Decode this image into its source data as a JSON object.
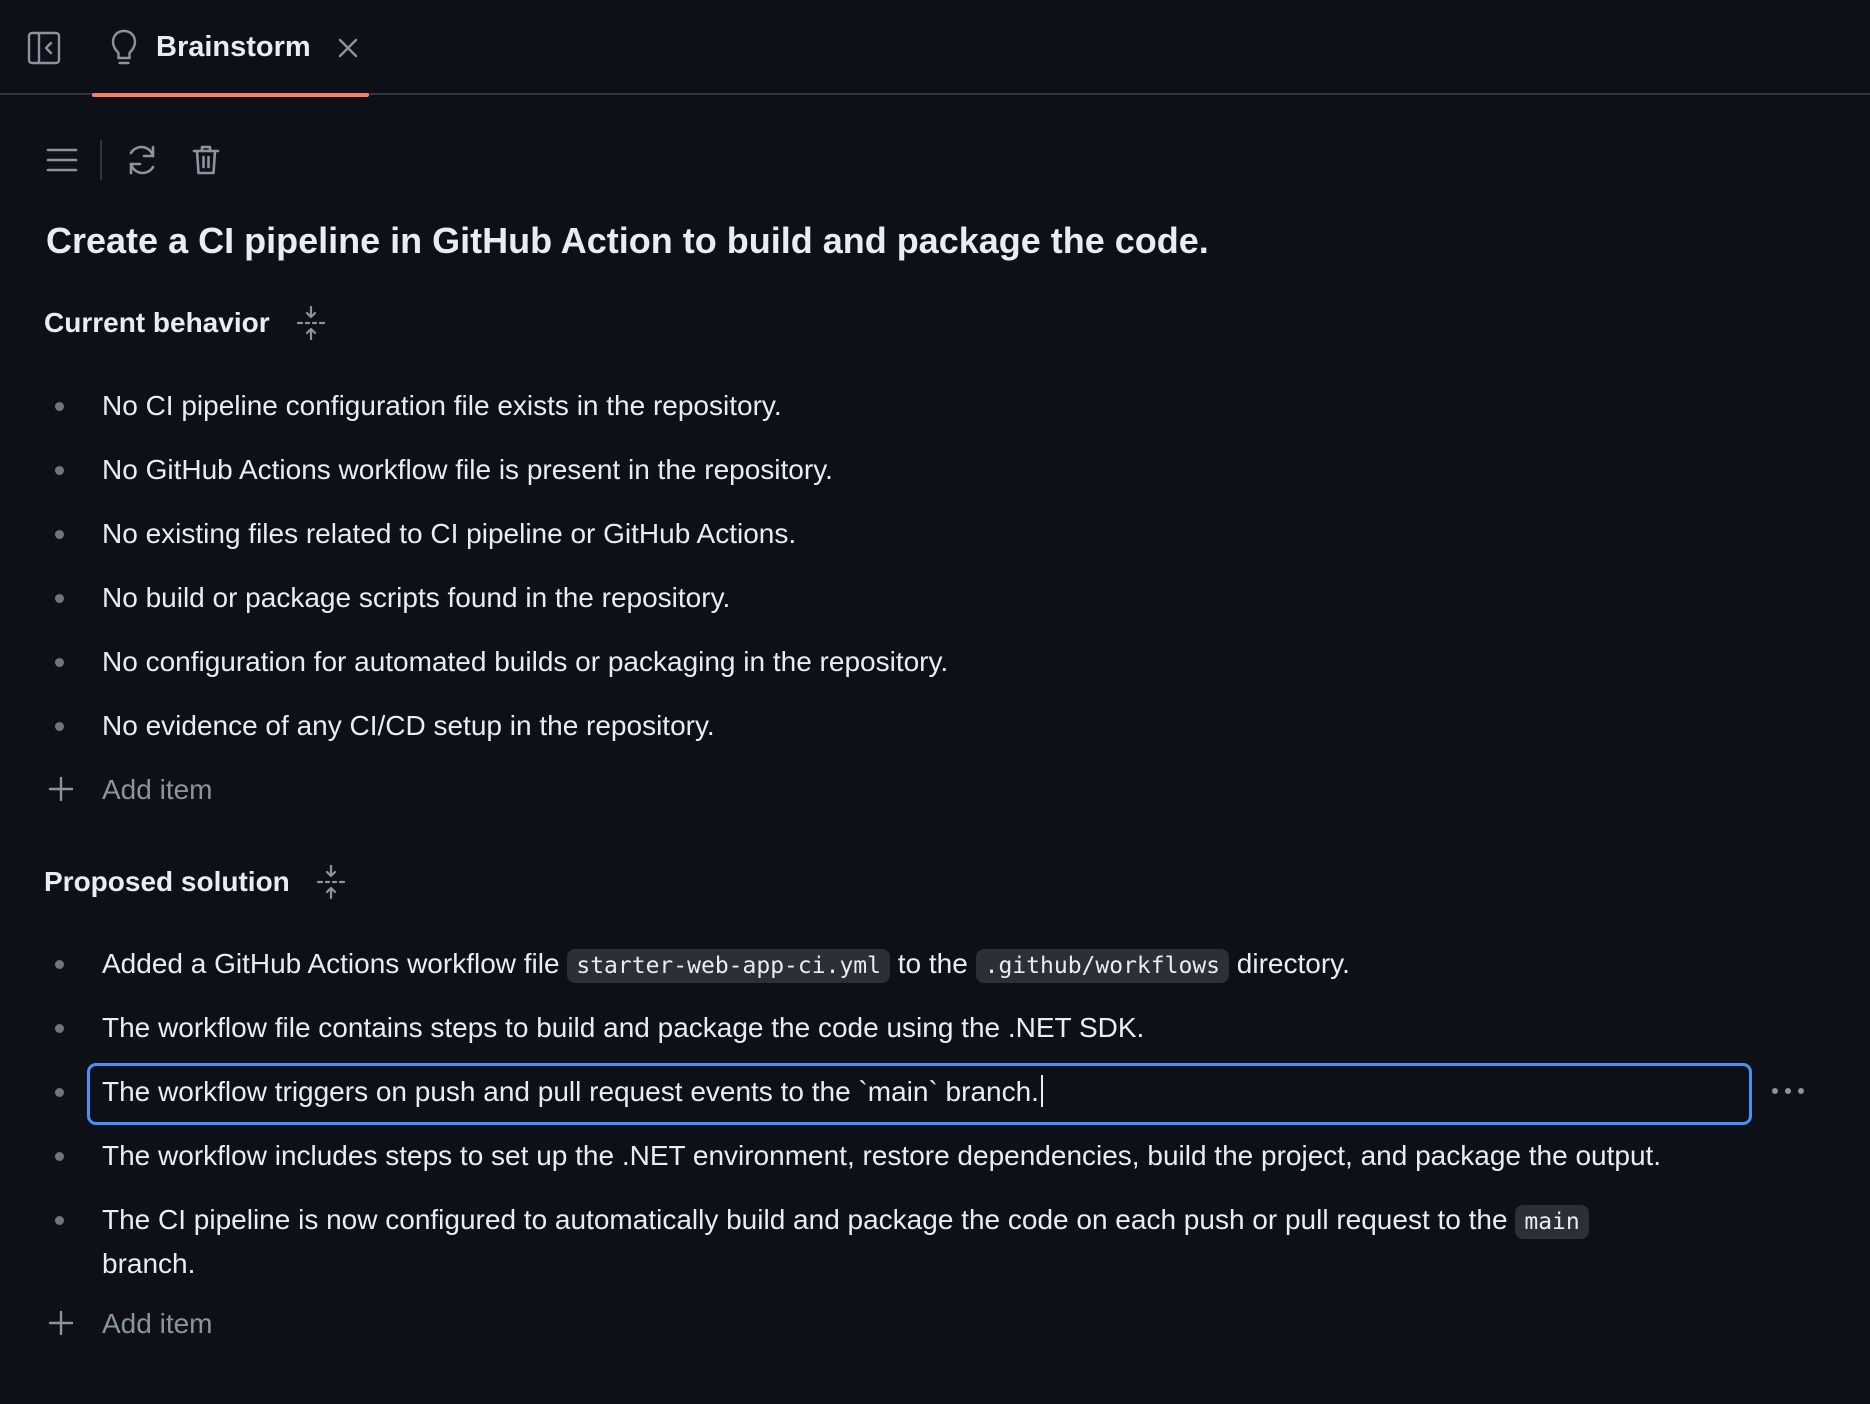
{
  "tabbar": {
    "tab": {
      "label": "Brainstorm"
    }
  },
  "toolbar": {
    "buttons": [
      "menu-icon",
      "refresh-icon",
      "trash-icon"
    ]
  },
  "page": {
    "title": "Create a CI pipeline in GitHub Action to build and package the code."
  },
  "current_behavior": {
    "title": "Current behavior",
    "items": [
      "No CI pipeline configuration file exists in the repository.",
      "No GitHub Actions workflow file is present in the repository.",
      "No existing files related to CI pipeline or GitHub Actions.",
      "No build or package scripts found in the repository.",
      "No configuration for automated builds or packaging in the repository.",
      "No evidence of any CI/CD setup in the repository."
    ],
    "add_label": "Add item"
  },
  "proposed_solution": {
    "title": "Proposed solution",
    "items": [
      {
        "before": "Added a GitHub Actions workflow file ",
        "code1": "starter-web-app-ci.yml",
        "middle": " to the ",
        "code2": ".github/workflows",
        "after": " directory."
      },
      {
        "text": "The workflow file contains steps to build and package the code using the .NET SDK."
      },
      {
        "text": "The workflow triggers on push and pull request events to the `main` branch."
      },
      {
        "text": "The workflow includes steps to set up the .NET environment, restore dependencies, build the project, and package the output."
      },
      {
        "before": "The CI pipeline is now configured to automatically build and package the code on each push or pull request to the ",
        "code1": "main",
        "after": " branch."
      }
    ],
    "add_label": "Add item"
  },
  "colors": {
    "background": "#0d1117",
    "text": "#e6edf3",
    "muted": "#8b949e",
    "accent_tab": "#f78166",
    "focus_border": "#4493f8"
  }
}
